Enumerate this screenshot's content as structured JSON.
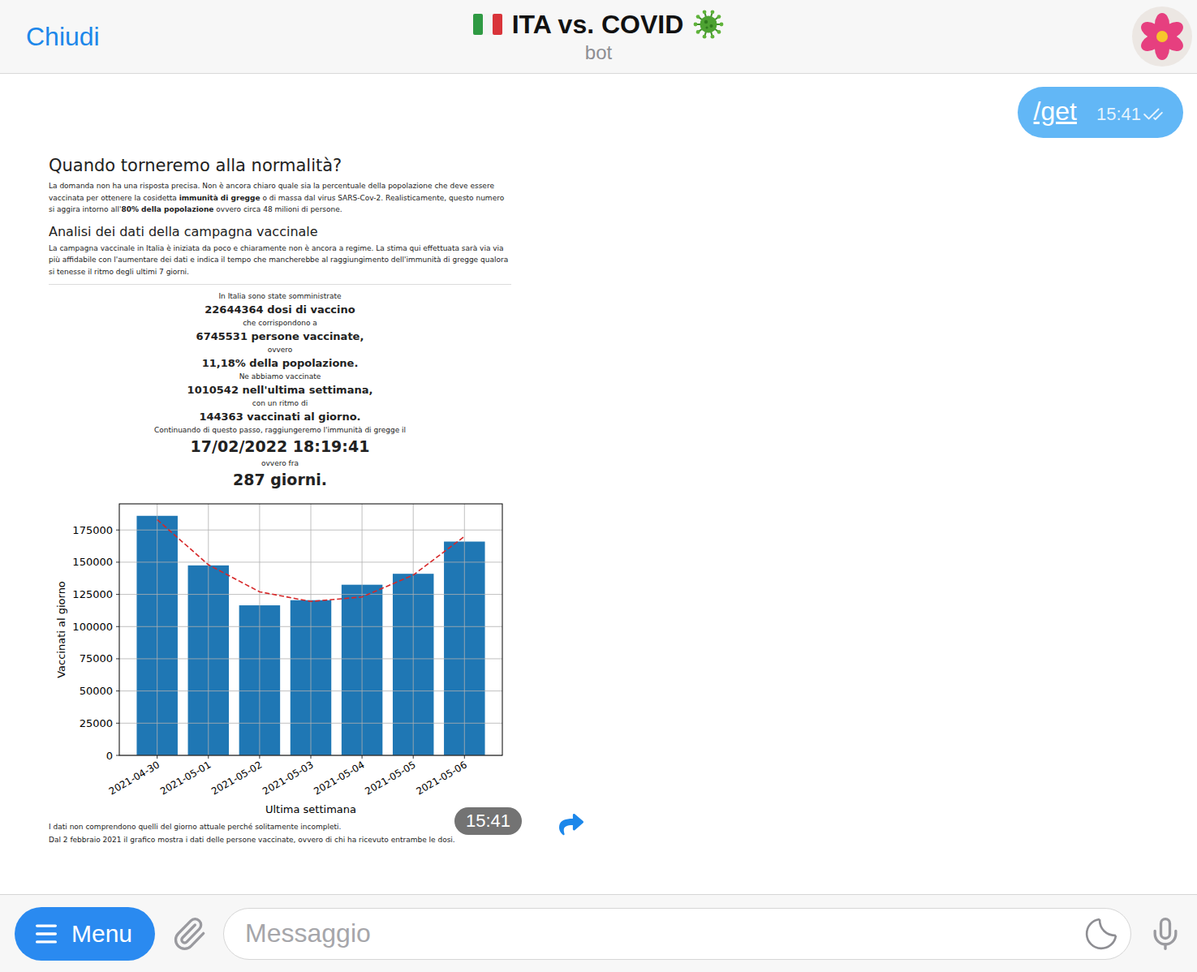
{
  "header": {
    "close": "Chiudi",
    "title": "ITA vs. COVID",
    "subtitle": "bot"
  },
  "outgoing": {
    "text": "/get",
    "time": "15:41",
    "read": true
  },
  "incoming": {
    "time": "15:41",
    "document": {
      "title": "Quando torneremo alla normalità?",
      "intro": [
        {
          "text": "La domanda non ha una risposta precisa. Non è ancora chiaro quale sia la percentuale della popolazione che deve essere vaccinata per ottenere la cosidetta ",
          "bold": false
        },
        {
          "text": "immunità di gregge",
          "bold": true
        },
        {
          "text": " o di massa dal virus SARS-Cov-2. Realisticamente, questo numero si aggira intorno all'",
          "bold": false
        },
        {
          "text": "80% della popolazione",
          "bold": true
        },
        {
          "text": " ovvero circa 48 milioni di persone.",
          "bold": false
        }
      ],
      "subtitle": "Analisi dei dati della campagna vaccinale",
      "analysis": "La campagna vaccinale in Italia è iniziata da poco e chiaramente non è ancora a regime. La stima qui effettuata sarà via via più affidabile con l'aumentare dei dati e indica il tempo che mancherebbe al raggiungimento dell'immunità di gregge qualora si tenesse il ritmo degli ultimi 7 giorni.",
      "stats": [
        {
          "label": "In Italia sono state somministrate",
          "value": "22644364 dosi di vaccino",
          "kind": "normal"
        },
        {
          "label": "che corrispondono a",
          "value": "6745531 persone vaccinate,",
          "kind": "normal"
        },
        {
          "label": "ovvero",
          "value": "11,18% della popolazione.",
          "kind": "normal"
        },
        {
          "label": "Ne abbiamo vaccinate",
          "value": "1010542 nell'ultima settimana,",
          "kind": "normal"
        },
        {
          "label": "con un ritmo di",
          "value": "144363 vaccinati al giorno.",
          "kind": "normal"
        },
        {
          "label": "Continuando di questo passo, raggiungeremo l'immunità di gregge il",
          "value": "17/02/2022 18:19:41",
          "kind": "large"
        },
        {
          "label": "ovvero fra",
          "value": "287 giorni.",
          "kind": "large"
        }
      ],
      "chart": {
        "y_label": "Vaccinati al giorno",
        "x_label": "Ultima settimana",
        "y_ticks": [
          "0",
          "25000",
          "50000",
          "75000",
          "100000",
          "125000",
          "150000",
          "175000"
        ],
        "categories": [
          "2021-04-30",
          "2021-05-01",
          "2021-05-02",
          "2021-05-03",
          "2021-05-04",
          "2021-05-05",
          "2021-05-06"
        ],
        "series": [
          {
            "kind": "bar",
            "color": "#1f77b4",
            "values": [
              186000,
              147500,
              116500,
              120500,
              132500,
              141000,
              166000
            ]
          },
          {
            "kind": "line",
            "color": "#d62728",
            "values": [
              183000,
              148000,
              127000,
              119500,
              123000,
              140000,
              170000
            ]
          }
        ]
      },
      "notes": [
        "I dati non comprendono quelli del giorno attuale perché solitamente incompleti.",
        "Dal 2 febbraio 2021 il grafico mostra i dati delle persone vaccinate, ovvero di chi ha ricevuto entrambe le dosi."
      ]
    }
  },
  "composer": {
    "menu": "Menu",
    "placeholder": "Messaggio"
  }
}
